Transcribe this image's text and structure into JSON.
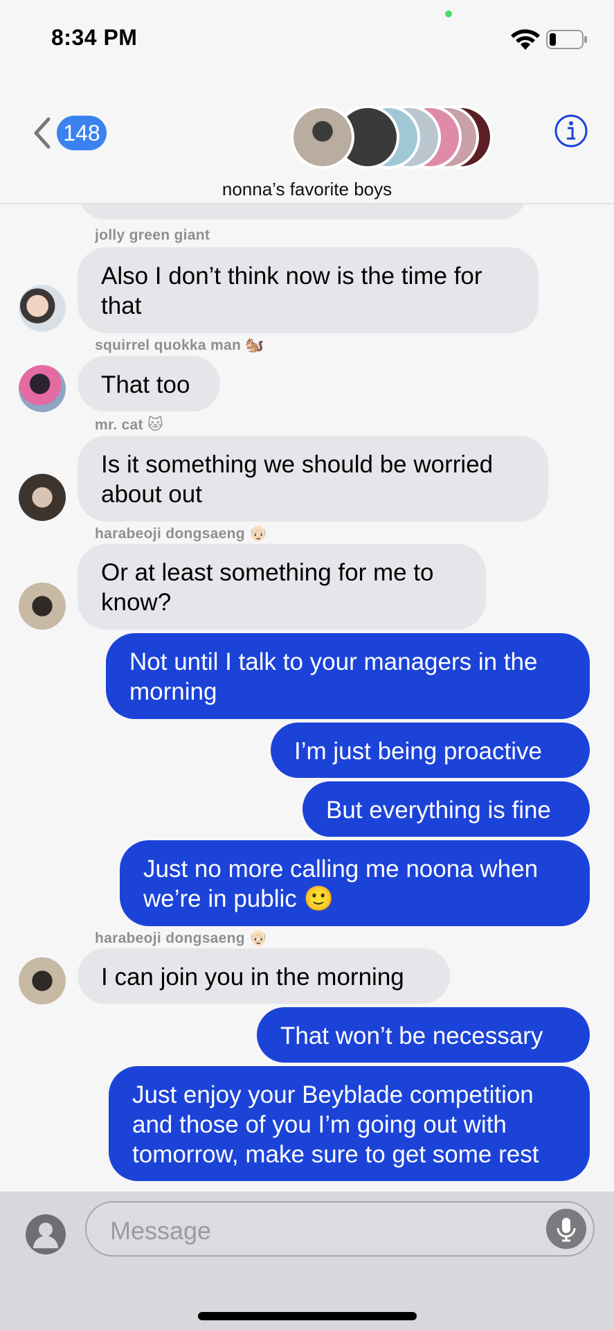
{
  "status": {
    "time": "8:34 PM"
  },
  "header": {
    "back_count": "148",
    "group_name": "nonna’s favorite boys"
  },
  "messages": {
    "sender_1": "jolly green giant",
    "msg_1": "Also I don’t think now is the time for that",
    "sender_2": "squirrel quokka man",
    "sender_2_emoji": "🐿️",
    "msg_2": "That too",
    "sender_3": "mr. cat",
    "sender_3_emoji": "🐱",
    "msg_3": "Is it something we should be worried about out",
    "sender_4": "harabeoji dongsaeng",
    "sender_4_emoji": "👴🏻",
    "msg_4": "Or at least something for me to know?",
    "out_1": "Not until I talk to your managers in the morning",
    "out_2": "I’m just being proactive",
    "out_3": "But everything is fine",
    "out_4": "Just no more calling me noona when we’re in public 🙂",
    "sender_5": "harabeoji dongsaeng",
    "sender_5_emoji": "👴🏻",
    "msg_5": "I can join you in the morning",
    "out_5": "That won’t be necessary",
    "out_6": "Just enjoy your Beyblade competition and those of you I’m going out with tomorrow, make sure to get some rest"
  },
  "input": {
    "placeholder": "Message"
  },
  "icons": {
    "back": "chevron-left-icon",
    "info": "info-icon",
    "mic": "microphone-icon",
    "profile": "person-icon",
    "wifi": "wifi-icon",
    "battery": "battery-icon"
  },
  "colors": {
    "outgoing_bubble": "#1c43d8",
    "incoming_bubble": "#e5e5ea",
    "accent": "#3b82f0"
  }
}
